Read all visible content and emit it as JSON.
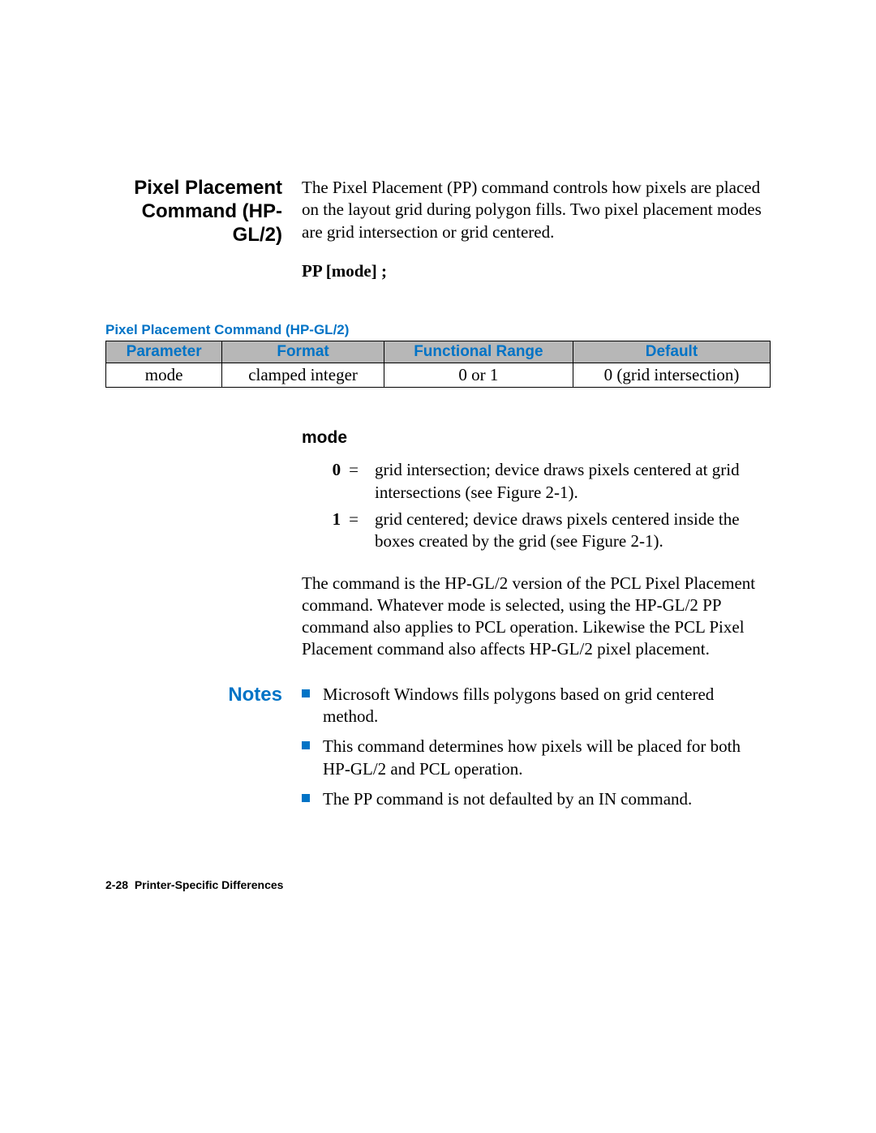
{
  "heading": {
    "title_line1": "Pixel Placement",
    "title_line2": "Command (HP-GL/2)",
    "description": "The Pixel Placement (PP) command controls how pixels are placed on the layout grid during polygon fills. Two pixel placement modes are grid intersection or grid centered."
  },
  "syntax": "PP [mode] ;",
  "table": {
    "caption": "Pixel Placement Command (HP-GL/2)",
    "headers": {
      "c0": "Parameter",
      "c1": "Format",
      "c2": "Functional Range",
      "c3": "Default"
    },
    "row": {
      "c0": "mode",
      "c1": "clamped integer",
      "c2": "0 or 1",
      "c3": "0 (grid intersection)"
    }
  },
  "mode_section": {
    "label": "mode",
    "items": [
      {
        "key_num": "0",
        "key_eq": "=",
        "text": "grid intersection; device draws pixels centered at grid intersections (see Figure 2-1)."
      },
      {
        "key_num": "1",
        "key_eq": "=",
        "text": "grid centered; device draws pixels centered inside the boxes created by the grid (see Figure 2-1)."
      }
    ],
    "paragraph": "The command is the HP-GL/2 version of the PCL Pixel Placement command. Whatever mode is selected, using the HP-GL/2 PP command also applies to PCL operation. Likewise the PCL Pixel Placement command also affects HP-GL/2 pixel placement."
  },
  "notes": {
    "label": "Notes",
    "items": [
      "Microsoft Windows fills polygons based on grid centered method.",
      "This command determines how pixels will be placed for both HP-GL/2 and PCL operation.",
      "The PP command is not defaulted by an IN command."
    ]
  },
  "footer": {
    "page": "2-28",
    "section": "Printer-Specific Differences"
  }
}
